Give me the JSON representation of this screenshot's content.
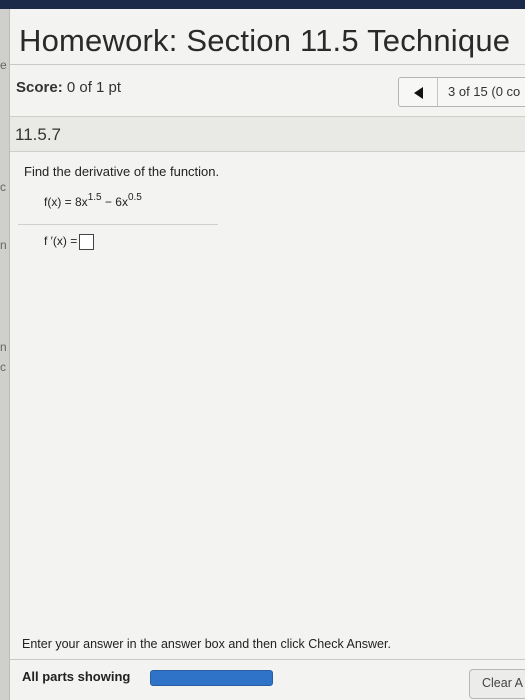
{
  "header": {
    "title": "Homework: Section 11.5 Technique"
  },
  "score": {
    "label": "Score:",
    "value": "0 of 1 pt"
  },
  "navigation": {
    "prev_icon": "triangle-left-icon",
    "position_text": "3 of 15 (0 co"
  },
  "question": {
    "number": "11.5.7",
    "instruction": "Find the derivative of the function.",
    "function_lhs": "f(x) = 8x",
    "exp1": "1.5",
    "function_mid": " − 6x",
    "exp2": "0.5",
    "answer_label": "f ′(x) ="
  },
  "footer": {
    "message": "Enter your answer in the answer box and then click Check Answer.",
    "parts_label": "All parts showing",
    "progress_fraction": 1.0,
    "clear_label": "Clear A"
  },
  "left_edge": {
    "glyph1": "e",
    "glyph2": "c",
    "glyph3": "n",
    "glyph4": "n",
    "glyph5": "c"
  },
  "colors": {
    "top_bar": "#1c2a4a",
    "progress_fill": "#2f73c8",
    "panel_bg": "#f3f3f1"
  }
}
